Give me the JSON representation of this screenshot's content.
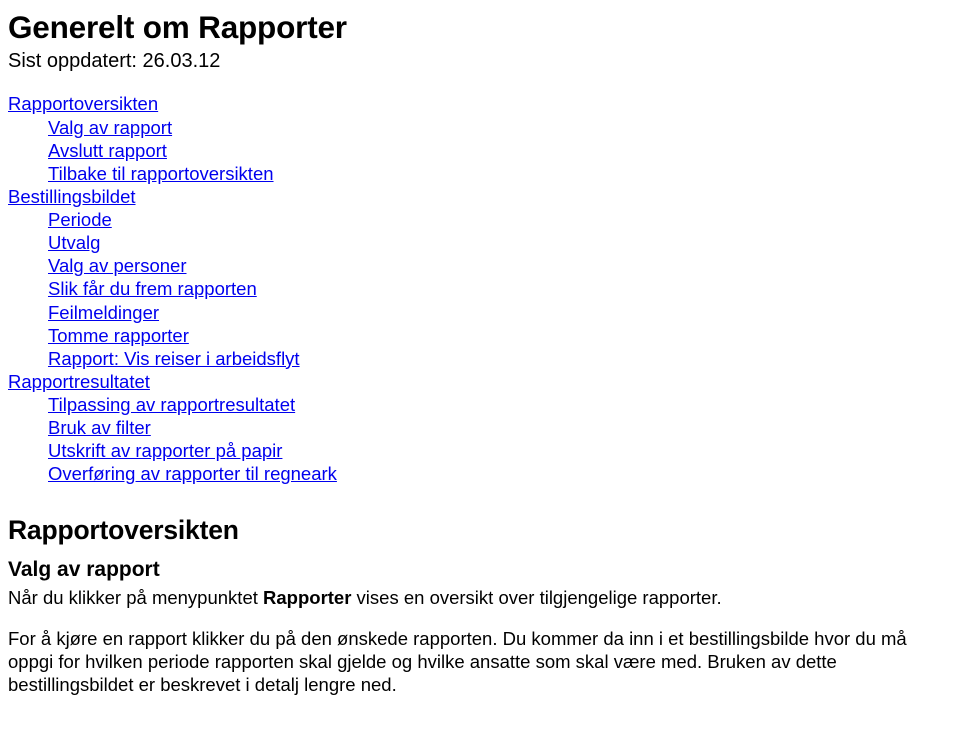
{
  "title": "Generelt om Rapporter",
  "updated": "Sist oppdatert: 26.03.12",
  "toc": [
    {
      "label": "Rapportoversikten",
      "indent": 0
    },
    {
      "label": "Valg av rapport",
      "indent": 1
    },
    {
      "label": "Avslutt rapport",
      "indent": 1
    },
    {
      "label": "Tilbake til rapportoversikten",
      "indent": 1
    },
    {
      "label": "Bestillingsbildet",
      "indent": 0
    },
    {
      "label": "Periode",
      "indent": 1
    },
    {
      "label": "Utvalg",
      "indent": 1
    },
    {
      "label": "Valg av personer",
      "indent": 1
    },
    {
      "label": "Slik får du frem rapporten",
      "indent": 1
    },
    {
      "label": "Feilmeldinger",
      "indent": 1
    },
    {
      "label": "Tomme rapporter",
      "indent": 1
    },
    {
      "label": "Rapport: Vis reiser i arbeidsflyt",
      "indent": 1
    },
    {
      "label": "Rapportresultatet",
      "indent": 0
    },
    {
      "label": "Tilpassing av rapportresultatet",
      "indent": 1
    },
    {
      "label": "Bruk av filter",
      "indent": 1
    },
    {
      "label": "Utskrift av rapporter på papir",
      "indent": 1
    },
    {
      "label": "Overføring av rapporter til regneark",
      "indent": 1
    }
  ],
  "section_h2": "Rapportoversikten",
  "section_h3": "Valg av rapport",
  "p1_a": "Når du klikker på menypunktet ",
  "p1_bold": "Rapporter",
  "p1_b": " vises en oversikt over tilgjengelige rapporter.",
  "p2": "For å kjøre en rapport klikker du på den ønskede rapporten. Du kommer da inn i et bestillingsbilde hvor du må oppgi for hvilken periode rapporten skal gjelde og hvilke ansatte som skal være med. Bruken av dette bestillingsbildet er beskrevet i detalj lengre ned."
}
